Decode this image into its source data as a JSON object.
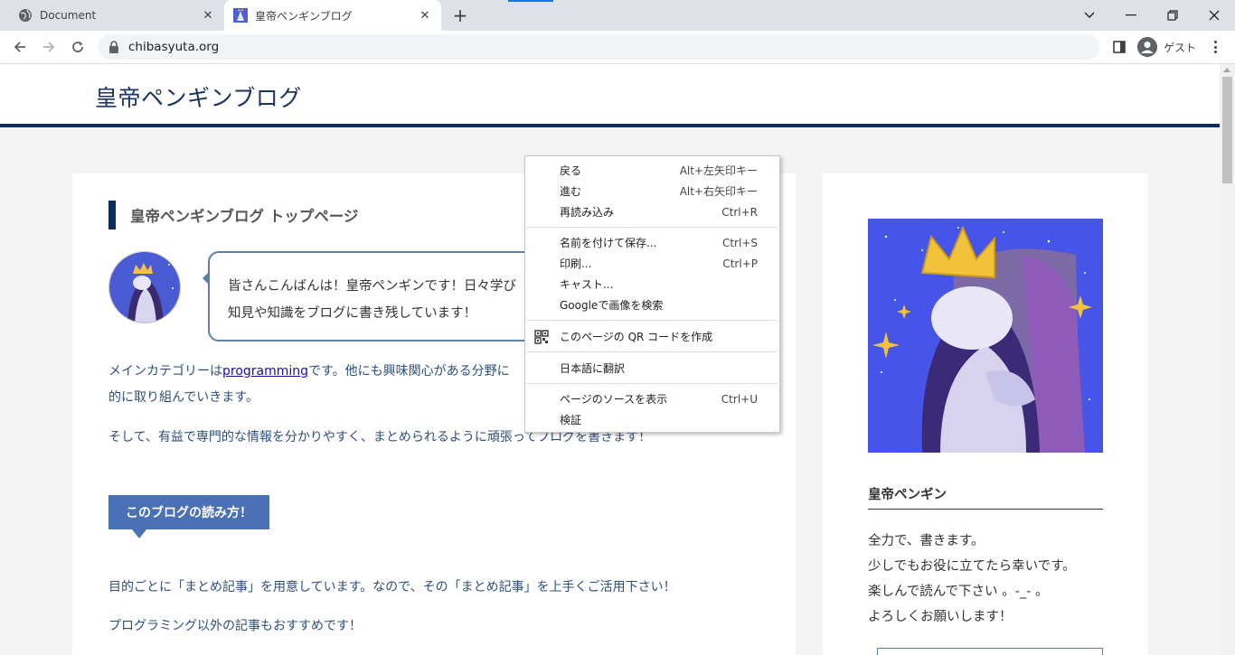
{
  "browser": {
    "tabs": [
      {
        "title": "Document",
        "active": false
      },
      {
        "title": "皇帝ペンギンブログ",
        "active": true
      }
    ],
    "url": "chibasyuta.org",
    "profile_label": "ゲスト",
    "accent_color": "#1a73e8"
  },
  "site": {
    "title": "皇帝ペンギンブログ",
    "brand_color": "#0d2d5c"
  },
  "main": {
    "heading": "皇帝ペンギンブログ トップページ",
    "bubble_lines": [
      "皆さんこんばんは！皇帝ペンギンです！日々学び",
      "知見や知識をブログに書き残しています！"
    ],
    "para1_prefix": "メインカテゴリーは",
    "para1_link": "programming",
    "para1_suffix": "です。他にも興味関心がある分野に",
    "para1_line2": "的に取り組んでいきます。",
    "para2": "そして、有益で専門的な情報を分かりやすく、まとめられるように頑張ってブログを書きます！",
    "label": "このブログの読み方！",
    "para3": "目的ごとに「まとめ記事」を用意しています。なので、その「まとめ記事」を上手くご活用下さい！",
    "para4": "プログラミング以外の記事もおすすめです！"
  },
  "sidebar": {
    "name": "皇帝ペンギン",
    "lines": [
      "全力で、書きます。",
      "少しでもお役に立てたら幸いです。",
      "楽しんで読んで下さい 。-_- 。",
      "よろしくお願いします！"
    ]
  },
  "context_menu": {
    "items": [
      {
        "label": "戻る",
        "shortcut": "Alt+左矢印キー"
      },
      {
        "label": "進む",
        "shortcut": "Alt+右矢印キー"
      },
      {
        "label": "再読み込み",
        "shortcut": "Ctrl+R"
      },
      {
        "label": "名前を付けて保存...",
        "shortcut": "Ctrl+S"
      },
      {
        "label": "印刷...",
        "shortcut": "Ctrl+P"
      },
      {
        "label": "キャスト...",
        "shortcut": ""
      },
      {
        "label": "Googleで画像を検索",
        "shortcut": ""
      },
      {
        "label": "このページの QR コードを作成",
        "shortcut": "",
        "icon": "qr-code-icon"
      },
      {
        "label": "日本語に翻訳",
        "shortcut": ""
      },
      {
        "label": "ページのソースを表示",
        "shortcut": "Ctrl+U"
      },
      {
        "label": "検証",
        "shortcut": ""
      }
    ]
  }
}
